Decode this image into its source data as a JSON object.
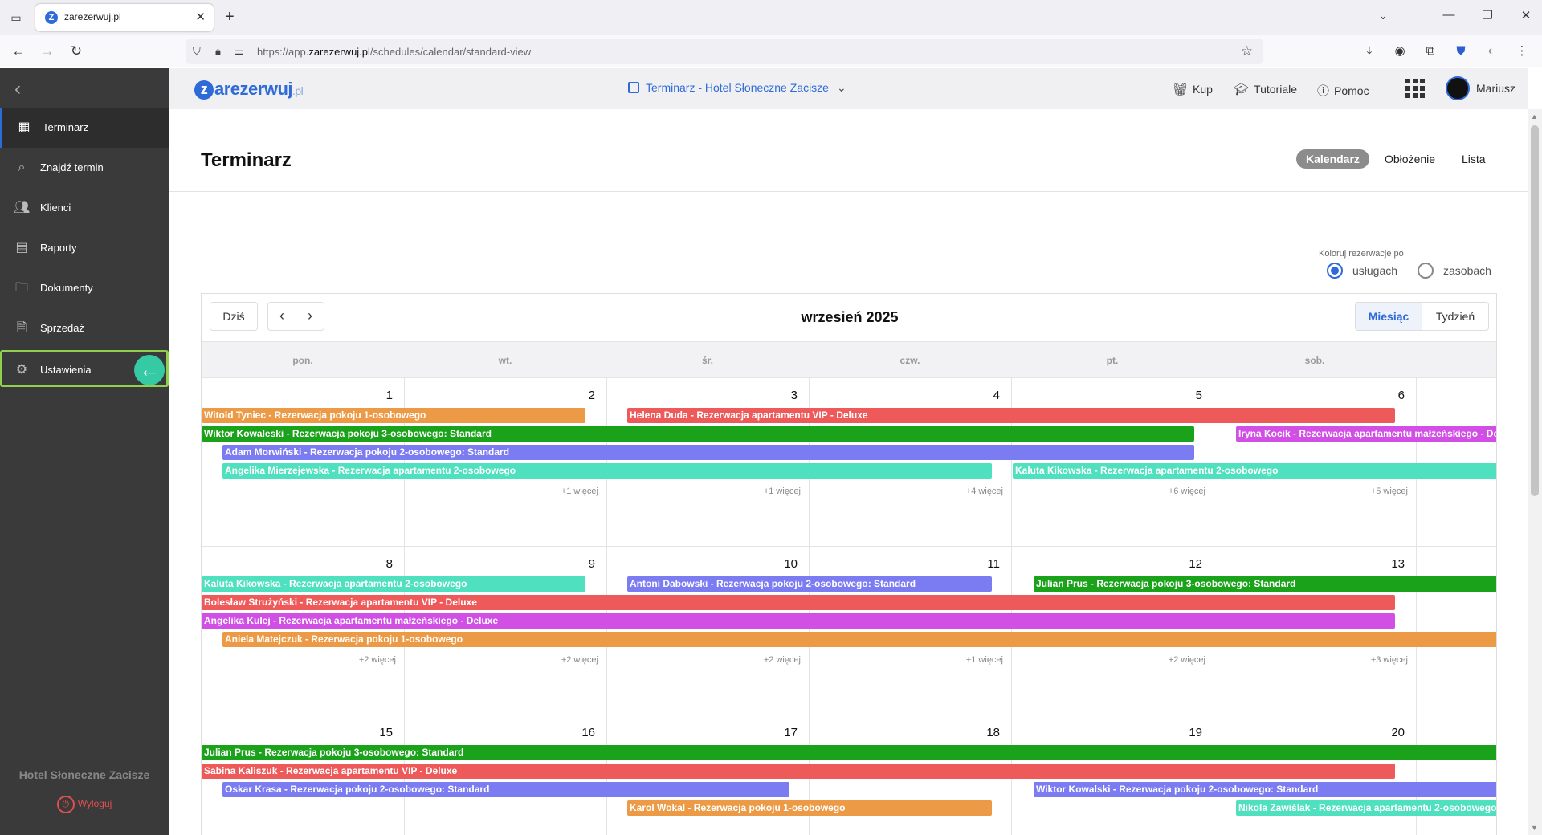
{
  "browser": {
    "tab_title": "zarezerwuj.pl",
    "url_prefix": "https://app.",
    "url_domain": "zarezerwuj.pl",
    "url_path": "/schedules/calendar/standard-view"
  },
  "sidebar": {
    "items": [
      {
        "label": "Terminarz",
        "icon": "calendar-icon"
      },
      {
        "label": "Znajdź termin",
        "icon": "search-icon"
      },
      {
        "label": "Klienci",
        "icon": "users-icon"
      },
      {
        "label": "Raporty",
        "icon": "report-icon"
      },
      {
        "label": "Dokumenty",
        "icon": "folder-icon"
      },
      {
        "label": "Sprzedaż",
        "icon": "document-icon"
      },
      {
        "label": "Ustawienia",
        "icon": "gear-icon"
      }
    ],
    "hotel_name": "Hotel Słoneczne Zacisze",
    "logout_label": "Wyloguj"
  },
  "header": {
    "logo_main": "arezerwuj",
    "logo_z": "z",
    "logo_suffix": ".pl",
    "schedule_selector": "Terminarz - Hotel Słoneczne Zacisze",
    "buy_label": "Kup",
    "tutorials_label": "Tutoriale",
    "help_label": "Pomoc",
    "user_name": "Mariusz"
  },
  "page": {
    "title": "Terminarz",
    "views": [
      "Kalendarz",
      "Obłożenie",
      "Lista"
    ],
    "active_view": "Kalendarz",
    "color_by_label": "Koloruj rezerwacje po",
    "color_by_options": [
      "usługach",
      "zasobach"
    ],
    "color_by_selected": "usługach"
  },
  "calendar": {
    "today_label": "Dziś",
    "month_title": "wrzesień 2025",
    "modes": [
      "Miesiąc",
      "Tydzień"
    ],
    "active_mode": "Miesiąc",
    "weekdays": [
      "pon.",
      "wt.",
      "śr.",
      "czw.",
      "pt.",
      "sob."
    ],
    "weeks": [
      {
        "days": [
          "1",
          "2",
          "3",
          "4",
          "5",
          "6"
        ],
        "more": [
          "+1 więcej",
          "+1 więcej",
          "+4 więcej",
          "+6 więcej",
          "+5 więcej"
        ],
        "events": [
          {
            "text": "Witold Tyniec - Rezerwacja pokoju 1-osobowego",
            "color": "#ec9a45"
          },
          {
            "text": "Helena Duda - Rezerwacja apartamentu VIP - Deluxe",
            "color": "#ee5a5a"
          },
          {
            "text": "Wiktor Kowaleski - Rezerwacja pokoju 3-osobowego: Standard",
            "color": "#1aa31a"
          },
          {
            "text": "Iryna Kocik - Rezerwacja apartamentu małżeńskiego - Deluxe",
            "color": "#d24fe6"
          },
          {
            "text": "Adam Morwiński - Rezerwacja pokoju 2-osobowego: Standard",
            "color": "#7b7bf2"
          },
          {
            "text": "Angelika Mierzejewska - Rezerwacja apartamentu 2-osobowego",
            "color": "#4fe0bf"
          },
          {
            "text": "Kaluta Kikowska - Rezerwacja apartamentu 2-osobowego",
            "color": "#4fe0bf"
          }
        ]
      },
      {
        "days": [
          "8",
          "9",
          "10",
          "11",
          "12",
          "13"
        ],
        "more": [
          "+2 więcej",
          "+2 więcej",
          "+2 więcej",
          "+1 więcej",
          "+2 więcej",
          "+3 więcej"
        ],
        "events": [
          {
            "text": "Kaluta Kikowska - Rezerwacja apartamentu 2-osobowego",
            "color": "#4fe0bf"
          },
          {
            "text": "Antoni Dabowski - Rezerwacja pokoju 2-osobowego: Standard",
            "color": "#7b7bf2"
          },
          {
            "text": "Julian Prus - Rezerwacja pokoju 3-osobowego: Standard",
            "color": "#1aa31a"
          },
          {
            "text": "Bolesław Strużyński - Rezerwacja apartamentu VIP - Deluxe",
            "color": "#ee5a5a"
          },
          {
            "text": "Angelika Kulej - Rezerwacja apartamentu małżeńskiego - Deluxe",
            "color": "#d24fe6"
          },
          {
            "text": "Aniela Matejczuk - Rezerwacja pokoju 1-osobowego",
            "color": "#ec9a45"
          }
        ]
      },
      {
        "days": [
          "15",
          "16",
          "17",
          "18",
          "19",
          "20"
        ],
        "events": [
          {
            "text": "Julian Prus - Rezerwacja pokoju 3-osobowego: Standard",
            "color": "#1aa31a"
          },
          {
            "text": "Sabina Kaliszuk - Rezerwacja apartamentu VIP - Deluxe",
            "color": "#ee5a5a"
          },
          {
            "text": "Oskar Krasa - Rezerwacja pokoju 2-osobowego: Standard",
            "color": "#7b7bf2"
          },
          {
            "text": "Wiktor Kowalski - Rezerwacja pokoju 2-osobowego: Standard",
            "color": "#7b7bf2"
          },
          {
            "text": "Karol Wokal - Rezerwacja pokoju 1-osobowego",
            "color": "#ec9a45"
          },
          {
            "text": "Nikola Zawiślak - Rezerwacja apartamentu 2-osobowego",
            "color": "#4fe0bf"
          }
        ]
      }
    ]
  },
  "colors": {
    "accent": "#2e6bd8",
    "sidebar_bg": "#3a3a3a",
    "highlight_outline": "#8fd14f",
    "pointer_arrow": "#35c9a4"
  }
}
